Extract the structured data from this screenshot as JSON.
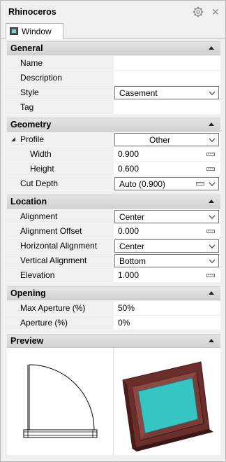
{
  "app": {
    "title": "Rhinoceros"
  },
  "tab": {
    "label": "Window"
  },
  "sections": {
    "general": "General",
    "geometry": "Geometry",
    "location": "Location",
    "opening": "Opening",
    "preview": "Preview"
  },
  "general": {
    "name": {
      "label": "Name",
      "value": ""
    },
    "description": {
      "label": "Description",
      "value": ""
    },
    "style": {
      "label": "Style",
      "value": "Casement"
    },
    "tag": {
      "label": "Tag",
      "value": ""
    }
  },
  "geometry": {
    "profile": {
      "label": "Profile",
      "value": "Other"
    },
    "width": {
      "label": "Width",
      "value": "0.900"
    },
    "height": {
      "label": "Height",
      "value": "0.600"
    },
    "cut_depth": {
      "label": "Cut Depth",
      "value": "Auto (0.900)"
    }
  },
  "location": {
    "alignment": {
      "label": "Alignment",
      "value": "Center"
    },
    "alignment_offset": {
      "label": "Alignment Offset",
      "value": "0.000"
    },
    "horizontal_alignment": {
      "label": "Horizontal Alignment",
      "value": "Center"
    },
    "vertical_alignment": {
      "label": "Vertical Alignment",
      "value": "Bottom"
    },
    "elevation": {
      "label": "Elevation",
      "value": "1.000"
    }
  },
  "opening": {
    "max_aperture": {
      "label": "Max Aperture (%)",
      "value": "50%"
    },
    "aperture": {
      "label": "Aperture (%)",
      "value": "0%"
    }
  },
  "icons": [
    "gear-icon",
    "close-icon",
    "window-tab-icon",
    "collapse-icon",
    "chevron-down-icon",
    "ruler-icon",
    "expand-triangle-icon"
  ],
  "colors": {
    "frame": "#5a2a26",
    "glass": "#35c6c4",
    "header_bg": "#dcdcdc",
    "label_bg": "#f0f0f0"
  }
}
